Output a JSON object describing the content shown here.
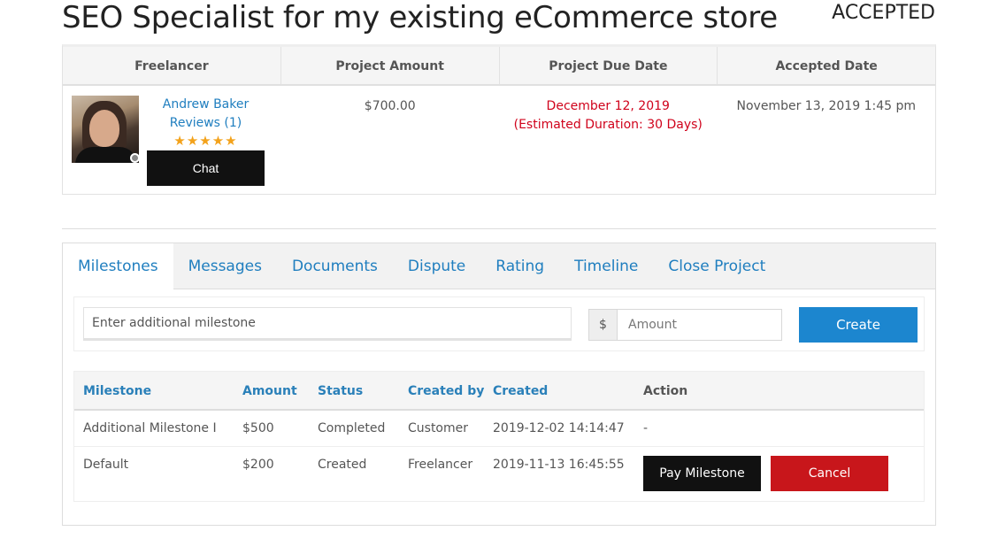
{
  "project": {
    "title": "SEO Specialist for my existing eCommerce store",
    "status": "ACCEPTED"
  },
  "summary": {
    "headers": [
      "Freelancer",
      "Project Amount",
      "Project Due Date",
      "Accepted Date"
    ],
    "freelancer": {
      "name": "Andrew Baker",
      "reviews": "Reviews (1)",
      "stars": "★★★★★",
      "rating": 5,
      "chat_label": "Chat",
      "online_status_color": "#888888"
    },
    "amount": "$700.00",
    "due_date": "December 12, 2019",
    "estimated_duration": "(Estimated Duration: 30 Days)",
    "accepted_date": "November 13, 2019 1:45 pm"
  },
  "tabs": [
    {
      "label": "Milestones",
      "active": true
    },
    {
      "label": "Messages",
      "active": false
    },
    {
      "label": "Documents",
      "active": false
    },
    {
      "label": "Dispute",
      "active": false
    },
    {
      "label": "Rating",
      "active": false
    },
    {
      "label": "Timeline",
      "active": false
    },
    {
      "label": "Close Project",
      "active": false
    }
  ],
  "milestone_form": {
    "milestone_placeholder": "Enter additional milestone",
    "milestone_value": "",
    "currency_symbol": "$",
    "amount_placeholder": "Amount",
    "amount_value": "",
    "create_label": "Create"
  },
  "milestones": {
    "headers": [
      "Milestone",
      "Amount",
      "Status",
      "Created by",
      "Created",
      "Action"
    ],
    "rows": [
      {
        "milestone": "Additional Milestone I",
        "amount": "$500",
        "status": "Completed",
        "created_by": "Customer",
        "created": "2019-12-02 14:14:47",
        "action": "-"
      },
      {
        "milestone": "Default",
        "amount": "$200",
        "status": "Created",
        "created_by": "Freelancer",
        "created": "2019-11-13 16:45:55",
        "pay_label": "Pay Milestone",
        "cancel_label": "Cancel"
      }
    ]
  },
  "colors": {
    "link": "#1f7ebf",
    "due_date": "#d0021b",
    "create_button": "#1c86cf",
    "cancel_button": "#c8161b",
    "stars": "#f3a21b"
  }
}
